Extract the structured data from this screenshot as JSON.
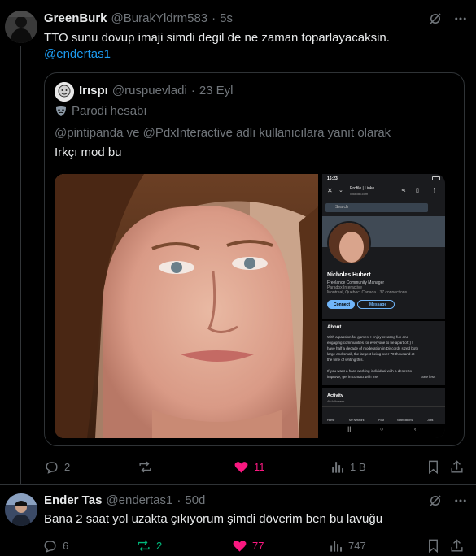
{
  "tweet1": {
    "name": "GreenBurk",
    "handle": "@BurakYldrm583",
    "sep": "·",
    "time": "5s",
    "text": "TTO sunu dovup imaji simdi degil de ne zaman toparlayacaksin.",
    "mention": "@endertas1",
    "replies": "2",
    "reposts": "",
    "likes": "11",
    "views": "1 B"
  },
  "quote": {
    "name": "Irıspı",
    "handle": "@ruspuevladi",
    "sep": "·",
    "time": "23 Eyl",
    "parody_label": "Parodi hesabı",
    "reply_context": "@pintipanda ve @PdxInteractive adlı kullanıcılara yanıt olarak",
    "text": "Irkçı mod bu",
    "phone": {
      "status_time": "16:23",
      "tab_title": "Profile | Linke...",
      "tab_url": "linkedin.com",
      "search": "Search",
      "profile_name": "Nicholas Hubert",
      "headline": "Freelance Community Manager",
      "company": "Paradox Interactive",
      "location": "Montreal, Quebec, Canada · 37 connections",
      "connect": "Connect",
      "message": "Message",
      "about_title": "About",
      "about_1": "With a passion for games, I enjoy creating fun and",
      "about_2": "engaging communities for everyone to be apart of :) I",
      "about_3": "have half a decade of moderation in Discords sized both",
      "about_4": "large and small, the largest being over 70 thousand at",
      "about_5": "the time of writing this.",
      "about_6": "If you want a hard working individual with a desire to",
      "about_7": "improve, get in contact with me!",
      "see_less": "See less",
      "activity_title": "Activity",
      "activity_sub": "40 followers",
      "nav_home": "Home",
      "nav_network": "My Network",
      "nav_post": "Post",
      "nav_notifications": "Notifications",
      "nav_jobs": "Jobs"
    }
  },
  "tweet2": {
    "name": "Ender Tas",
    "handle": "@endertas1",
    "sep": "·",
    "time": "50d",
    "text": "Bana 2 saat yol uzakta çıkıyorum şimdi döverim ben bu lavuğu",
    "replies": "6",
    "reposts": "2",
    "likes": "77",
    "views": "747"
  },
  "colors": {
    "like": "#f91880",
    "repost_active": "#00ba7c",
    "link": "#1d9bf0",
    "muted": "#71767b"
  }
}
